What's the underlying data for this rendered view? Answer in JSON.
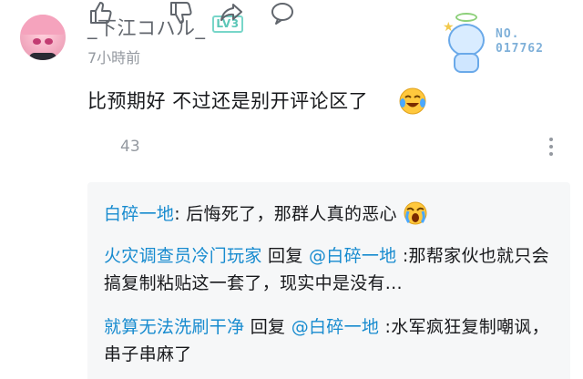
{
  "header": {
    "username": "_下江コハル_",
    "level_badge": "LV3",
    "timestamp": "7小時前",
    "decoration": {
      "label": "NO.",
      "number": "017762"
    }
  },
  "comment": {
    "text": "比预期好 不过还是别开评论区了",
    "emoji": "cry-laugh-emoji"
  },
  "actions": {
    "like_count": "43",
    "icons": [
      "thumbs-up-icon",
      "thumbs-down-icon",
      "share-icon",
      "comment-icon",
      "more-icon"
    ]
  },
  "replies": [
    {
      "name": "白碎一地",
      "separator": ": ",
      "text": "后悔死了，那群人真的恶心",
      "emoji": "crying-emoji"
    },
    {
      "name": "火灾调查员冷门玩家",
      "reply_word": " 回复 ",
      "mention": "@白碎一地",
      "text": " :那帮家伙也就只会搞复制粘贴这一套了，现实中是没有..."
    },
    {
      "name": "就算无法洗刷干净",
      "reply_word": " 回复 ",
      "mention": "@白碎一地",
      "text": " :水军疯狂复制嘲讽，串子串麻了"
    }
  ],
  "colors": {
    "link_blue": "#178bcf",
    "muted_gray": "#9499a0",
    "level_teal": "#5cc7b8",
    "reply_bg": "#f6f7f8"
  }
}
